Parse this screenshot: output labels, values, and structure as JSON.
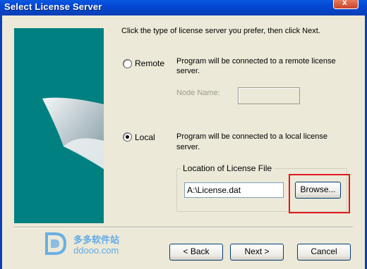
{
  "window": {
    "title": "Select License Server",
    "close_label": "x"
  },
  "intro": "Click the type of license server you prefer, then click Next.",
  "remote": {
    "label": "Remote",
    "selected": false,
    "description_line1": "Program will be connected to a remote license",
    "description_line2": "server.",
    "node_name_label": "Node Name:",
    "node_name_value": ""
  },
  "local": {
    "label": "Local",
    "selected": true,
    "description_line1": "Program will be connected to a local license",
    "description_line2": "server."
  },
  "license_file": {
    "group_label": "Location of License File",
    "path_value": "A:\\License.dat",
    "browse_label": "Browse..."
  },
  "footer": {
    "back_label": "< Back",
    "next_label": "Next >",
    "cancel_label": "Cancel"
  },
  "watermark": {
    "site_cn": "多多软件站",
    "site_url": "ddooo.com"
  },
  "colors": {
    "titlebar": "#0a58e0",
    "panel": "#008080",
    "highlight": "#e0191f"
  }
}
